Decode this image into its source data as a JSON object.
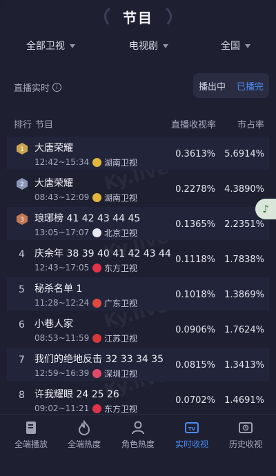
{
  "header": {
    "title": "节目"
  },
  "filters": [
    {
      "label": "全部卫视"
    },
    {
      "label": "电视剧"
    },
    {
      "label": "全国"
    }
  ],
  "live": {
    "label": "直播实时",
    "info_icon": "i",
    "toggle": {
      "on_air": "播出中",
      "finished": "已播完"
    }
  },
  "table": {
    "headers": {
      "rank": "排行",
      "program": "节目",
      "rating": "直播收视率",
      "share": "市占率"
    },
    "rows": [
      {
        "rank": "1",
        "name": "大唐荣耀",
        "time": "12:42~15:34",
        "station": "湖南卫视",
        "rating": "0.3613%",
        "share": "5.6914%",
        "station_color": "#e2b63a"
      },
      {
        "rank": "2",
        "name": "大唐荣耀",
        "time": "08:43~12:09",
        "station": "湖南卫视",
        "rating": "0.2278%",
        "share": "4.3890%",
        "station_color": "#e2b63a"
      },
      {
        "rank": "3",
        "name": "琅琊榜 41 42 43 44 45",
        "time": "13:05~17:07",
        "station": "北京卫视",
        "rating": "0.1365%",
        "share": "2.2351%",
        "station_color": "#e8e8ee"
      },
      {
        "rank": "4",
        "name": "庆余年 38 39 40 41 42 43 44",
        "time": "12:43~17:05",
        "station": "东方卫视",
        "rating": "0.1118%",
        "share": "1.7838%",
        "station_color": "#e2334b"
      },
      {
        "rank": "5",
        "name": "秘杀名单 1",
        "time": "11:28~12:24",
        "station": "广东卫视",
        "rating": "0.1018%",
        "share": "1.3869%",
        "station_color": "#e04a3c"
      },
      {
        "rank": "6",
        "name": "小巷人家",
        "time": "08:53~11:59",
        "station": "江苏卫视",
        "rating": "0.0906%",
        "share": "1.7624%",
        "station_color": "#d9383a"
      },
      {
        "rank": "7",
        "name": "我们的绝地反击 32 33 34 35",
        "time": "12:59~16:39",
        "station": "深圳卫视",
        "rating": "0.0815%",
        "share": "1.3413%",
        "station_color": "#e24a6a"
      },
      {
        "rank": "8",
        "name": "许我耀眼 24 25 26",
        "time": "09:02~11:21",
        "station": "东方卫视",
        "rating": "0.0702%",
        "share": "1.4691%",
        "station_color": "#e2334b"
      }
    ]
  },
  "watermark": "Ky.live",
  "float_button": {
    "icon": "music-note-icon",
    "glyph": "♪"
  },
  "nav": [
    {
      "label": "全端播放",
      "icon": "book-icon",
      "active": false
    },
    {
      "label": "全端热度",
      "icon": "flame-icon",
      "active": false
    },
    {
      "label": "角色热度",
      "icon": "person-icon",
      "active": false
    },
    {
      "label": "实时收视",
      "icon": "tv-icon",
      "active": true
    },
    {
      "label": "历史收视",
      "icon": "history-tv-icon",
      "active": false
    }
  ],
  "colors": {
    "background": "#1e2032",
    "accent": "#4b8af3",
    "gold": "#c9a650",
    "silver": "#8a96b8",
    "bronze": "#c27a56"
  }
}
